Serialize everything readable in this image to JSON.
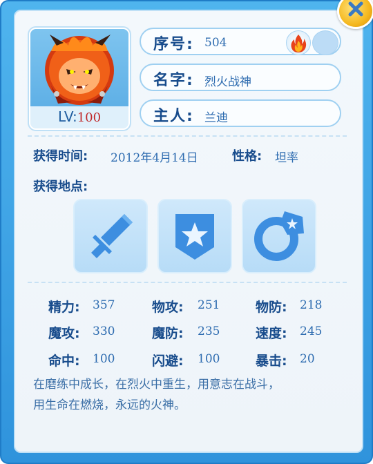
{
  "pet": {
    "level_label": "LV:",
    "level_value": "100",
    "fields": {
      "number_label": "序号:",
      "number_value": "504",
      "name_label": "名字:",
      "name_value": "烈火战神",
      "owner_label": "主人:",
      "owner_value": "兰迪"
    },
    "obtain_time_label": "获得时间:",
    "obtain_time_value": "2012年4月14日",
    "nature_label": "性格:",
    "nature_value": "坦率",
    "obtain_location_label": "获得地点:",
    "location_icons": [
      "sword-icon",
      "shield-star-icon",
      "ring-star-icon"
    ],
    "stats": [
      {
        "label": "精力:",
        "value": "357"
      },
      {
        "label": "物攻:",
        "value": "251"
      },
      {
        "label": "物防:",
        "value": "218"
      },
      {
        "label": "魔攻:",
        "value": "330"
      },
      {
        "label": "魔防:",
        "value": "235"
      },
      {
        "label": "速度:",
        "value": "245"
      },
      {
        "label": "命中:",
        "value": "100"
      },
      {
        "label": "闪避:",
        "value": "100"
      },
      {
        "label": "暴击:",
        "value": "20"
      }
    ],
    "description_line1": "在磨练中成长，在烈火中重生，用意志在战斗，",
    "description_line2": "用生命在燃烧，永远的火神。"
  },
  "colors": {
    "frame": "#3aa2e3",
    "label": "#184c8c",
    "value": "#2e6cb0",
    "level": "#c0292b"
  }
}
